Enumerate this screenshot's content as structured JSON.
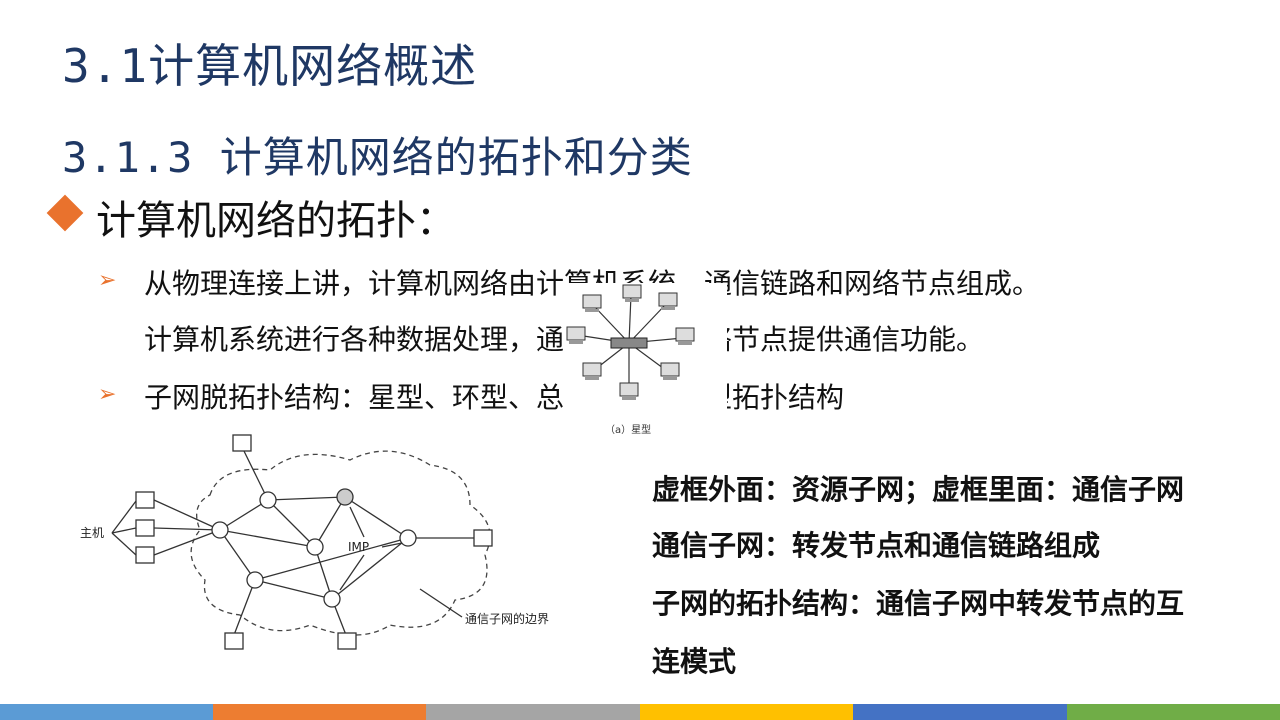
{
  "title": "3.1计算机网络概述",
  "subtitle": "3.1.3 计算机网络的拓扑和分类",
  "section_heading": "计算机网络的拓扑：",
  "bullets": [
    "从物理连接上讲，计算机网络由计算机系统、通信链路和网络节点组成。",
    "计算机系统进行各种数据处理，通信链路和网络节点提供通信功能。",
    "子网脱拓扑结构：星型、环型、总线型等规则型拓扑结构"
  ],
  "star_caption": "（a）星型",
  "diagram_labels": {
    "host": "主机",
    "imp": "IMP",
    "boundary": "通信子网的边界"
  },
  "notes": [
    "虚框外面：资源子网；虚框里面：通信子网",
    "通信子网：转发节点和通信链路组成",
    "子网的拓扑结构：通信子网中转发节点的互",
    "连模式"
  ],
  "colors": {
    "title": "#1f3864",
    "accent": "#e9722d",
    "bars": [
      "#5b9bd5",
      "#ed7d31",
      "#a5a5a5",
      "#ffc000",
      "#4472c4",
      "#70ad47"
    ]
  },
  "icons": {
    "heading_bullet": "diamond-icon",
    "list_bullet": "arrow-right-icon"
  }
}
